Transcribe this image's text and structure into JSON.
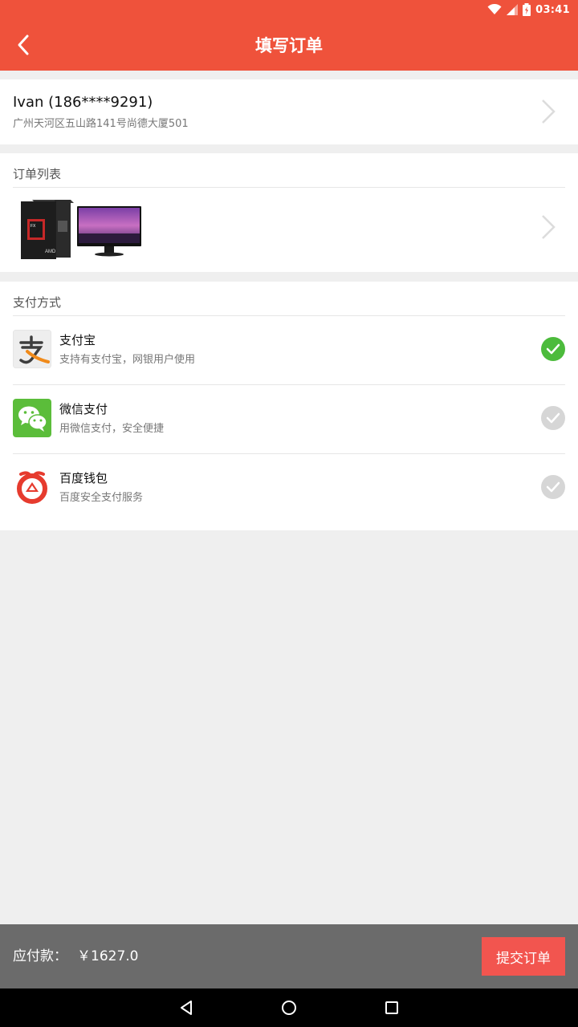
{
  "status_bar": {
    "time": "03:41"
  },
  "header": {
    "title": "填写订单",
    "back_icon": "back-arrow-icon"
  },
  "address": {
    "name_phone": "Ivan (186****9291)",
    "detail": "广州天河区五山路141号尚德大厦501"
  },
  "orders": {
    "section_title": "订单列表",
    "products": [
      {
        "icon": "computer-case-icon"
      },
      {
        "icon": "monitor-icon"
      }
    ]
  },
  "payment": {
    "section_title": "支付方式",
    "methods": [
      {
        "name": "支付宝",
        "desc": "支持有支付宝，网银用户使用",
        "selected": true,
        "icon": "alipay-icon"
      },
      {
        "name": "微信支付",
        "desc": "用微信支付，安全便捷",
        "selected": false,
        "icon": "wechat-pay-icon"
      },
      {
        "name": "百度钱包",
        "desc": "百度安全支付服务",
        "selected": false,
        "icon": "baidu-wallet-icon"
      }
    ]
  },
  "footer": {
    "total_label": "应付款：",
    "total_amount": "￥1627.0",
    "submit_label": "提交订单"
  },
  "colors": {
    "header": "#ef523b",
    "selected_check": "#4cbb3c",
    "unselected_check": "#d6d6d6",
    "submit": "#f2554f",
    "footer_bg": "#6b6b6b"
  }
}
